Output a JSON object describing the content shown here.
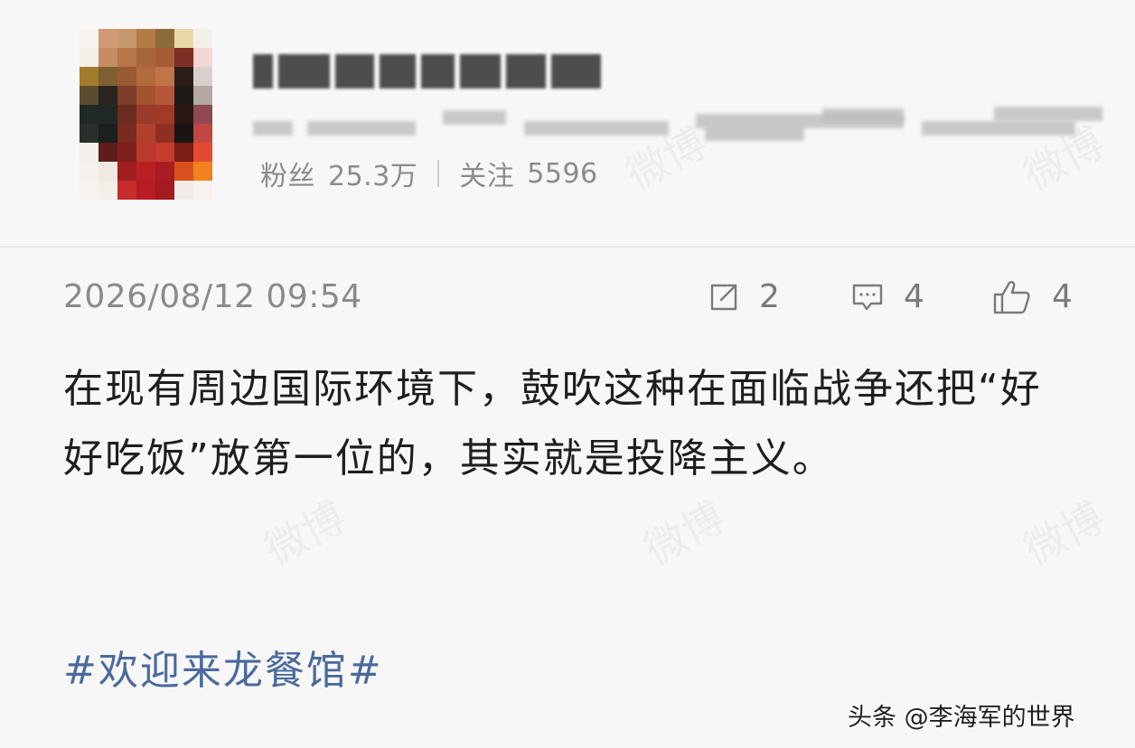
{
  "profile": {
    "stats": {
      "fans_label": "粉丝",
      "fans_value": "25.3万",
      "follow_label": "关注",
      "follow_value": "5596"
    }
  },
  "post": {
    "timestamp": "2026/08/12 09:54",
    "actions": {
      "repost_icon": "repost-icon",
      "repost_count": "2",
      "comment_icon": "comment-icon",
      "comment_count": "4",
      "like_icon": "thumbs-up-icon",
      "like_count": "4"
    },
    "text": "在现有周边国际环境下，鼓吹这种在面临战争还把“好好吃饭”放第一位的，其实就是投降主义。",
    "hashtag": "#欢迎来龙餐馆#"
  },
  "watermark": {
    "text": "微博"
  },
  "credit": "头条 @李海军的世界",
  "colors": {
    "background": "#f7f7f7",
    "text": "#1e1e1e",
    "meta": "#8a8a8a",
    "hashtag": "#4a6a9c"
  }
}
